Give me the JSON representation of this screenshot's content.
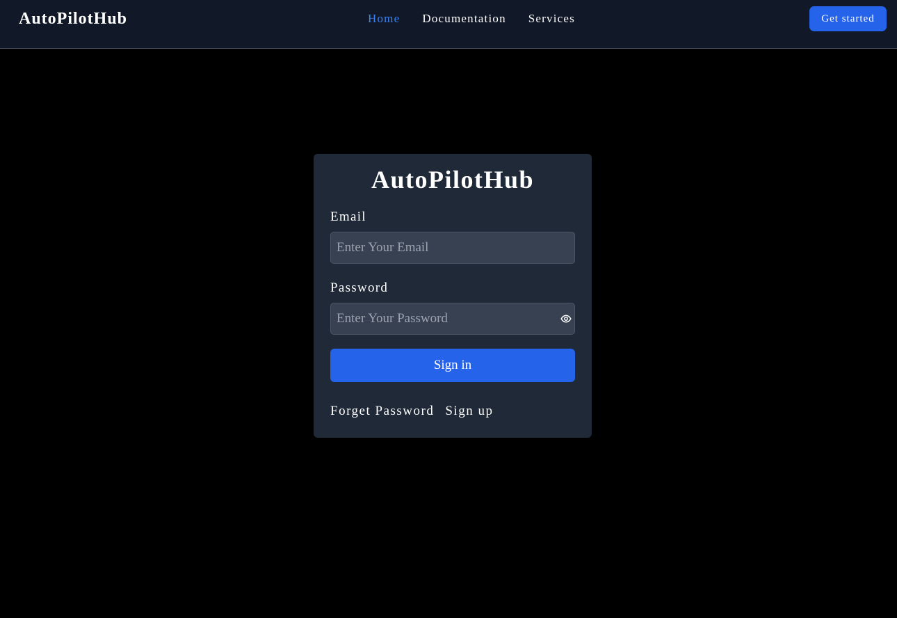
{
  "header": {
    "brand": "AutoPilotHub",
    "nav": [
      {
        "label": "Home",
        "active": true
      },
      {
        "label": "Documentation",
        "active": false
      },
      {
        "label": "Services",
        "active": false
      }
    ],
    "cta_label": "Get started"
  },
  "login": {
    "title": "AutoPilotHub",
    "email_label": "Email",
    "email_placeholder": "Enter Your Email",
    "email_value": "",
    "password_label": "Password",
    "password_placeholder": "Enter Your Password",
    "password_value": "",
    "password_toggle_icon": "eye-icon",
    "submit_label": "Sign in",
    "forgot_label": "Forget Password",
    "signup_label": "Sign up"
  },
  "colors": {
    "background": "#000000",
    "navbar": "#111827",
    "card": "#1f2937",
    "input": "#374151",
    "accent": "#2563eb",
    "active_link": "#3b82f6"
  }
}
